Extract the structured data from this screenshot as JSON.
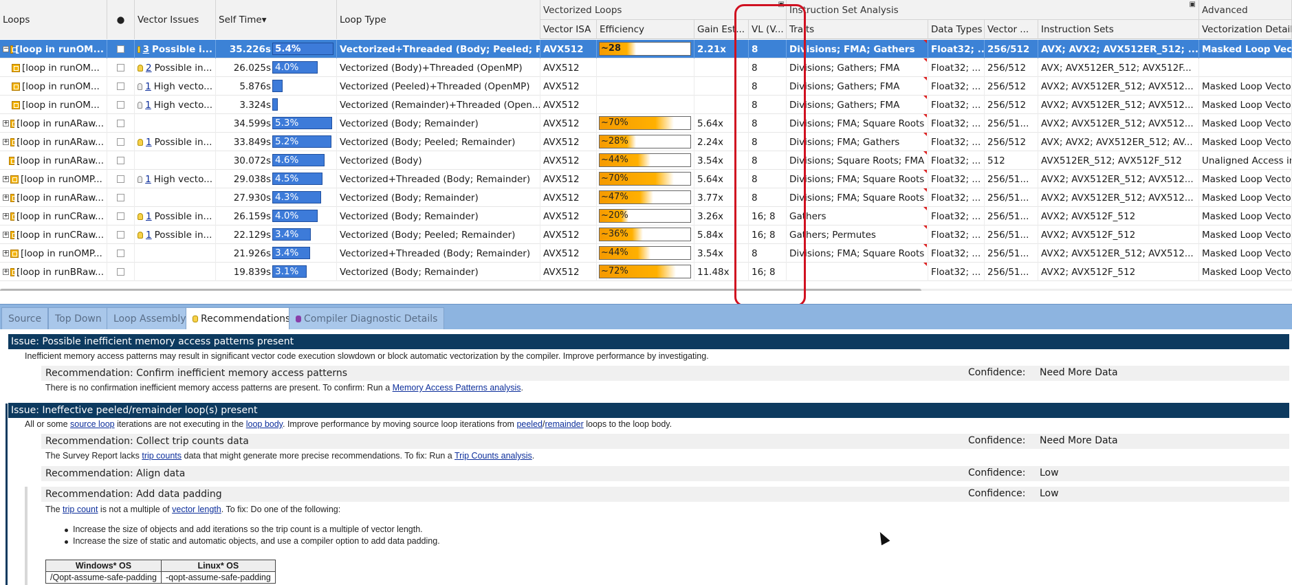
{
  "header": {
    "loops": "Loops",
    "vector_issues": "Vector Issues",
    "self_time": "Self Time▾",
    "loop_type": "Loop Type",
    "vectorized_loops": "Vectorized Loops",
    "instruction_set_analysis": "Instruction Set Analysis",
    "advanced": "Advanced",
    "vector_isa": "Vector ISA",
    "efficiency": "Efficiency",
    "gain": "Gain Est...",
    "vl": "VL (V...",
    "traits": "Traits",
    "data_types": "Data Types",
    "vector_widths": "Vector ...",
    "instruction_sets": "Instruction Sets",
    "vectorization_details": "Vectorization Details"
  },
  "rows": [
    {
      "expander": "−",
      "loop": "[loop in runOM...",
      "bulb": "yellow",
      "issue_count": "3",
      "issue": "Possible i...",
      "self_time": "35.226s",
      "pct": "5.4%",
      "bar": 0.95,
      "loop_type": "Vectorized+Threaded (Body; Peeled; Re...",
      "isa": "AVX512",
      "eff": "~28",
      "eff_fill": 0.28,
      "gain": "2.21x",
      "vl": "8",
      "traits": "Divisions; FMA; Gathers",
      "data_types": "Float32; ...",
      "widths": "256/512",
      "isets": "AVX; AVX2; AVX512ER_512; ...",
      "details": "Masked Loop Vecto"
    },
    {
      "expander": "",
      "loop": "[loop in runOM...",
      "bulb": "yellow",
      "issue_count": "2",
      "issue": "Possible in...",
      "self_time": "26.025s",
      "pct": "4.0%",
      "bar": 0.7,
      "loop_type": "Vectorized (Body)+Threaded (OpenMP)",
      "isa": "AVX512",
      "eff": "",
      "eff_fill": 0,
      "gain": "",
      "vl": "8",
      "traits": "Divisions; Gathers; FMA",
      "data_types": "Float32; ...",
      "widths": "256/512",
      "isets": "AVX; AVX512ER_512; AVX512F...",
      "details": ""
    },
    {
      "expander": "",
      "loop": "[loop in runOM...",
      "bulb": "gray",
      "issue_count": "1",
      "issue": "High vecto...",
      "self_time": "5.876s",
      "pct": "",
      "bar": 0.16,
      "loop_type": "Vectorized (Peeled)+Threaded (OpenMP)",
      "isa": "AVX512",
      "eff": "",
      "eff_fill": 0,
      "gain": "",
      "vl": "8",
      "traits": "Divisions; Gathers; FMA",
      "data_types": "Float32; ...",
      "widths": "256/512",
      "isets": "AVX2; AVX512ER_512; AVX512...",
      "details": "Masked Loop Vecto"
    },
    {
      "expander": "",
      "loop": "[loop in runOM...",
      "bulb": "gray",
      "issue_count": "1",
      "issue": "High vecto...",
      "self_time": "3.324s",
      "pct": "",
      "bar": 0.09,
      "loop_type": "Vectorized (Remainder)+Threaded (Open...",
      "isa": "AVX512",
      "eff": "",
      "eff_fill": 0,
      "gain": "",
      "vl": "8",
      "traits": "Divisions; Gathers; FMA",
      "data_types": "Float32; ...",
      "widths": "256/512",
      "isets": "AVX2; AVX512ER_512; AVX512...",
      "details": "Masked Loop Vecto"
    },
    {
      "expander": "+",
      "loop": "[loop in runARaw...",
      "bulb": "",
      "issue_count": "",
      "issue": "",
      "self_time": "34.599s",
      "pct": "5.3%",
      "bar": 0.93,
      "loop_type": "Vectorized (Body; Remainder)",
      "isa": "AVX512",
      "eff": "~70%",
      "eff_fill": 0.7,
      "gain": "5.64x",
      "vl": "8",
      "traits": "Divisions; FMA; Square Roots",
      "data_types": "Float32; ...",
      "widths": "256/51...",
      "isets": "AVX2; AVX512ER_512; AVX512...",
      "details": "Masked Loop Vecto"
    },
    {
      "expander": "+",
      "loop": "[loop in runARaw...",
      "bulb": "yellow",
      "issue_count": "1",
      "issue": "Possible in...",
      "self_time": "33.849s",
      "pct": "5.2%",
      "bar": 0.91,
      "loop_type": "Vectorized (Body; Peeled; Remainder)",
      "isa": "AVX512",
      "eff": "~28%",
      "eff_fill": 0.28,
      "gain": "2.24x",
      "vl": "8",
      "traits": "Divisions; FMA; Gathers",
      "data_types": "Float32; ...",
      "widths": "256/512",
      "isets": "AVX; AVX2; AVX512ER_512; AV...",
      "details": "Masked Loop Vecto"
    },
    {
      "expander": "",
      "loop": "[loop in runARaw...",
      "bulb": "",
      "issue_count": "",
      "issue": "",
      "self_time": "30.072s",
      "pct": "4.6%",
      "bar": 0.81,
      "loop_type": "Vectorized (Body)",
      "isa": "AVX512",
      "eff": "~44%",
      "eff_fill": 0.44,
      "gain": "3.54x",
      "vl": "8",
      "traits": "Divisions; Square Roots; FMA",
      "data_types": "Float32; ...",
      "widths": "512",
      "isets": "AVX512ER_512; AVX512F_512",
      "details": "Unaligned Access in"
    },
    {
      "expander": "+",
      "loop": "[loop in runOMP...",
      "bulb": "gray",
      "issue_count": "1",
      "issue": "High vecto...",
      "self_time": "29.038s",
      "pct": "4.5%",
      "bar": 0.78,
      "loop_type": "Vectorized+Threaded (Body; Remainder)",
      "isa": "AVX512",
      "eff": "~70%",
      "eff_fill": 0.7,
      "gain": "5.64x",
      "vl": "8",
      "traits": "Divisions; FMA; Square Roots",
      "data_types": "Float32; ...",
      "widths": "256/51...",
      "isets": "AVX2; AVX512ER_512; AVX512...",
      "details": "Masked Loop Vecto"
    },
    {
      "expander": "+",
      "loop": "[loop in runARaw...",
      "bulb": "",
      "issue_count": "",
      "issue": "",
      "self_time": "27.930s",
      "pct": "4.3%",
      "bar": 0.75,
      "loop_type": "Vectorized (Body; Remainder)",
      "isa": "AVX512",
      "eff": "~47%",
      "eff_fill": 0.47,
      "gain": "3.77x",
      "vl": "8",
      "traits": "Divisions; FMA; Square Roots",
      "data_types": "Float32; ...",
      "widths": "256/51...",
      "isets": "AVX2; AVX512ER_512; AVX512...",
      "details": "Masked Loop Vecto"
    },
    {
      "expander": "+",
      "loop": "[loop in runCRaw...",
      "bulb": "yellow",
      "issue_count": "1",
      "issue": "Possible in...",
      "self_time": "26.159s",
      "pct": "4.0%",
      "bar": 0.7,
      "loop_type": "Vectorized (Body; Remainder)",
      "isa": "AVX512",
      "eff": "~20%",
      "eff_fill": 0.2,
      "gain": "3.26x",
      "vl": "16; 8",
      "traits": "Gathers",
      "data_types": "Float32; ...",
      "widths": "256/51...",
      "isets": "AVX2; AVX512F_512",
      "details": "Masked Loop Vecto"
    },
    {
      "expander": "+",
      "loop": "[loop in runCRaw...",
      "bulb": "yellow",
      "issue_count": "1",
      "issue": "Possible in...",
      "self_time": "22.129s",
      "pct": "3.4%",
      "bar": 0.6,
      "loop_type": "Vectorized (Body; Peeled; Remainder)",
      "isa": "AVX512",
      "eff": "~36%",
      "eff_fill": 0.36,
      "gain": "5.84x",
      "vl": "16; 8",
      "traits": "Gathers; Permutes",
      "data_types": "Float32; ...",
      "widths": "256/51...",
      "isets": "AVX2; AVX512F_512",
      "details": "Masked Loop Vecto"
    },
    {
      "expander": "+",
      "loop": "[loop in runOMP...",
      "bulb": "",
      "issue_count": "",
      "issue": "",
      "self_time": "21.926s",
      "pct": "3.4%",
      "bar": 0.59,
      "loop_type": "Vectorized+Threaded (Body; Remainder)",
      "isa": "AVX512",
      "eff": "~44%",
      "eff_fill": 0.44,
      "gain": "3.54x",
      "vl": "8",
      "traits": "Divisions; FMA; Square Roots",
      "data_types": "Float32; ...",
      "widths": "256/51...",
      "isets": "AVX2; AVX512ER_512; AVX512...",
      "details": "Masked Loop Vecto"
    },
    {
      "expander": "+",
      "loop": "[loop in runBRaw...",
      "bulb": "",
      "issue_count": "",
      "issue": "",
      "self_time": "19.839s",
      "pct": "3.1%",
      "bar": 0.53,
      "loop_type": "Vectorized (Body; Remainder)",
      "isa": "AVX512",
      "eff": "~72%",
      "eff_fill": 0.72,
      "gain": "11.48x",
      "vl": "16; 8",
      "traits": "",
      "data_types": "Float32; ...",
      "widths": "256/51...",
      "isets": "AVX2; AVX512F_512",
      "details": "Masked Loop Vecto"
    }
  ],
  "tabs": [
    {
      "label": "Source",
      "active": false
    },
    {
      "label": "Top Down",
      "active": false
    },
    {
      "label": "Loop Assembly",
      "active": false
    },
    {
      "label": "Recommendations",
      "active": true
    },
    {
      "label": "Compiler Diagnostic Details",
      "active": false
    }
  ],
  "recs": {
    "issue1": "Issue: Possible inefficient memory access patterns present",
    "issue1_desc": "Inefficient memory access patterns may result in significant vector code execution slowdown or block automatic vectorization by the compiler. Improve performance by investigating.",
    "rec1": "Recommendation: Confirm inefficient memory access patterns",
    "rec1_text": "There is no confirmation inefficient memory access patterns are present. To confirm: Run a ",
    "rec1_link": "Memory Access Patterns analysis",
    "confidence_label": "Confidence:",
    "rec1_conf": "Need More Data",
    "issue2": "Issue: Ineffective peeled/remainder loop(s) present",
    "issue2_a": "All or some ",
    "issue2_link1": "source loop",
    "issue2_b": " iterations are not executing in the ",
    "issue2_link2": "loop body",
    "issue2_c": ". Improve performance by moving source loop iterations from ",
    "issue2_link3": "peeled",
    "issue2_sep": "/",
    "issue2_link4": "remainder",
    "issue2_d": " loops to the loop body.",
    "rec2": "Recommendation: Collect trip counts data",
    "rec2_conf": "Need More Data",
    "rec2_a": "The Survey Report lacks ",
    "rec2_link1": "trip counts",
    "rec2_b": " data that might generate more precise recommendations. To fix: Run a ",
    "rec2_link2": "Trip Counts analysis",
    "rec3": "Recommendation: Align data",
    "rec3_conf": "Low",
    "rec4": "Recommendation: Add data padding",
    "rec4_conf": "Low",
    "rec4_a": "The ",
    "rec4_link1": "trip count",
    "rec4_b": " is not a multiple of ",
    "rec4_link2": "vector length",
    "rec4_c": ". To fix: Do one of the following:",
    "bullet1": "Increase the size of objects and add iterations so the trip count is a multiple of vector length.",
    "bullet2": "Increase the size of static and automatic objects, and use a compiler option to add data padding.",
    "os_win": "Windows* OS",
    "os_linux": "Linux* OS",
    "opt_win": "/Qopt-assume-safe-padding",
    "opt_linux": "-qopt-assume-safe-padding"
  }
}
